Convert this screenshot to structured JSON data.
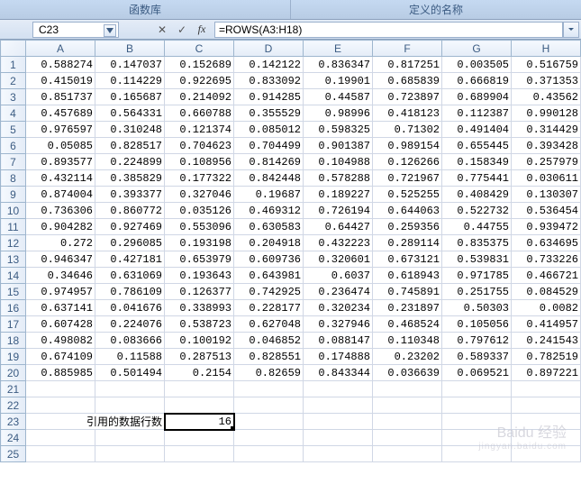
{
  "ribbon": {
    "group1": "函数库",
    "group2": "定义的名称"
  },
  "namebox": {
    "value": "C23"
  },
  "formula": {
    "value": "=ROWS(A3:H18)"
  },
  "columns": [
    "A",
    "B",
    "C",
    "D",
    "E",
    "F",
    "G",
    "H"
  ],
  "row_headers": [
    "1",
    "2",
    "3",
    "4",
    "5",
    "6",
    "7",
    "8",
    "9",
    "10",
    "11",
    "12",
    "13",
    "14",
    "15",
    "16",
    "17",
    "18",
    "19",
    "20",
    "21",
    "22",
    "23",
    "24",
    "25"
  ],
  "data_rows": [
    [
      "0.588274",
      "0.147037",
      "0.152689",
      "0.142122",
      "0.836347",
      "0.817251",
      "0.003505",
      "0.516759"
    ],
    [
      "0.415019",
      "0.114229",
      "0.922695",
      "0.833092",
      "0.19901",
      "0.685839",
      "0.666819",
      "0.371353"
    ],
    [
      "0.851737",
      "0.165687",
      "0.214092",
      "0.914285",
      "0.44587",
      "0.723897",
      "0.689904",
      "0.43562"
    ],
    [
      "0.457689",
      "0.564331",
      "0.660788",
      "0.355529",
      "0.98996",
      "0.418123",
      "0.112387",
      "0.990128"
    ],
    [
      "0.976597",
      "0.310248",
      "0.121374",
      "0.085012",
      "0.598325",
      "0.71302",
      "0.491404",
      "0.314429"
    ],
    [
      "0.05085",
      "0.828517",
      "0.704623",
      "0.704499",
      "0.901387",
      "0.989154",
      "0.655445",
      "0.393428"
    ],
    [
      "0.893577",
      "0.224899",
      "0.108956",
      "0.814269",
      "0.104988",
      "0.126266",
      "0.158349",
      "0.257979"
    ],
    [
      "0.432114",
      "0.385829",
      "0.177322",
      "0.842448",
      "0.578288",
      "0.721967",
      "0.775441",
      "0.030611"
    ],
    [
      "0.874004",
      "0.393377",
      "0.327046",
      "0.19687",
      "0.189227",
      "0.525255",
      "0.408429",
      "0.130307"
    ],
    [
      "0.736306",
      "0.860772",
      "0.035126",
      "0.469312",
      "0.726194",
      "0.644063",
      "0.522732",
      "0.536454"
    ],
    [
      "0.904282",
      "0.927469",
      "0.553096",
      "0.630583",
      "0.64427",
      "0.259356",
      "0.44755",
      "0.939472"
    ],
    [
      "0.272",
      "0.296085",
      "0.193198",
      "0.204918",
      "0.432223",
      "0.289114",
      "0.835375",
      "0.634695"
    ],
    [
      "0.946347",
      "0.427181",
      "0.653979",
      "0.609736",
      "0.320601",
      "0.673121",
      "0.539831",
      "0.733226"
    ],
    [
      "0.34646",
      "0.631069",
      "0.193643",
      "0.643981",
      "0.6037",
      "0.618943",
      "0.971785",
      "0.466721"
    ],
    [
      "0.974957",
      "0.786109",
      "0.126377",
      "0.742925",
      "0.236474",
      "0.745891",
      "0.251755",
      "0.084529"
    ],
    [
      "0.637141",
      "0.041676",
      "0.338993",
      "0.228177",
      "0.320234",
      "0.231897",
      "0.50303",
      "0.0082"
    ],
    [
      "0.607428",
      "0.224076",
      "0.538723",
      "0.627048",
      "0.327946",
      "0.468524",
      "0.105056",
      "0.414957"
    ],
    [
      "0.498082",
      "0.083666",
      "0.100192",
      "0.046852",
      "0.088147",
      "0.110348",
      "0.797612",
      "0.241543"
    ],
    [
      "0.674109",
      "0.11588",
      "0.287513",
      "0.828551",
      "0.174888",
      "0.23202",
      "0.589337",
      "0.782519"
    ],
    [
      "0.885985",
      "0.501494",
      "0.2154",
      "0.82659",
      "0.843344",
      "0.036639",
      "0.069521",
      "0.897221"
    ]
  ],
  "row23": {
    "label": "引用的数据行数",
    "value": "16"
  },
  "watermark": {
    "main": "Baidu 经验",
    "sub": "jingyan.baidu.com"
  }
}
